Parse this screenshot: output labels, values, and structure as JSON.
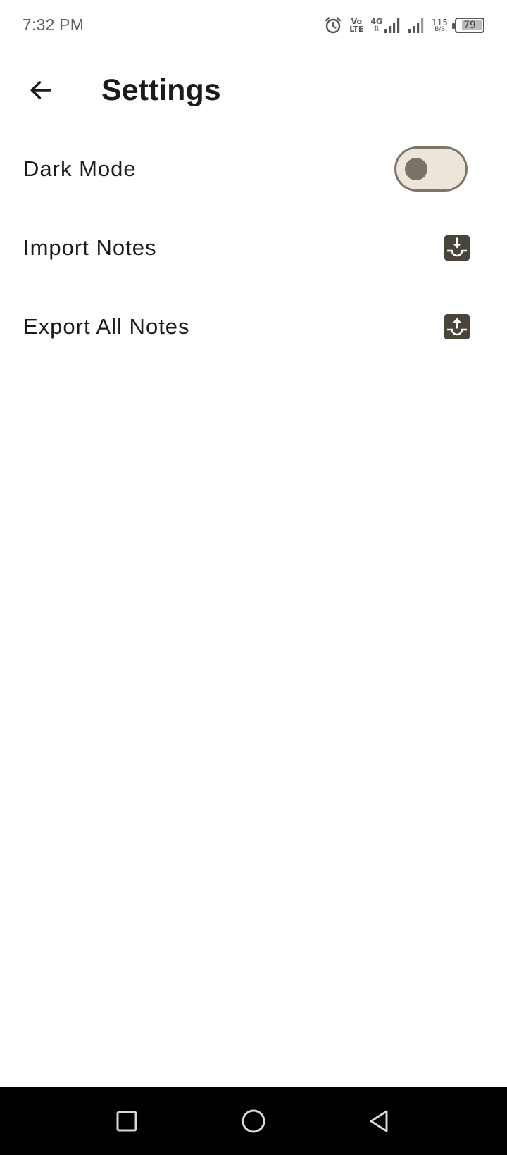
{
  "status_bar": {
    "time": "7:32 PM",
    "volte_top": "Vo",
    "volte_bottom": "LTE",
    "network_type": "4G",
    "speed_value": "115",
    "speed_unit": "B/S",
    "battery_level": "79",
    "icons": [
      "alarm-icon",
      "volte-icon",
      "signal-icon",
      "signal-icon",
      "battery-icon"
    ]
  },
  "app_bar": {
    "title": "Settings",
    "back_icon": "arrow-back-icon"
  },
  "settings": [
    {
      "label": "Dark Mode",
      "control": "toggle",
      "enabled": false
    },
    {
      "label": "Import Notes",
      "control": "icon",
      "icon": "inbox-download-icon"
    },
    {
      "label": "Export All Notes",
      "control": "icon",
      "icon": "inbox-upload-icon"
    }
  ],
  "nav_bar": {
    "icons": [
      "recents-square-icon",
      "home-circle-icon",
      "back-triangle-icon"
    ]
  },
  "colors": {
    "text": "#1c1b17",
    "toggle_track": "#ece5d9",
    "toggle_border": "#7d7565",
    "toggle_knob": "#7a7264",
    "icon_fill": "#4a4539",
    "nav_background": "#000000"
  }
}
